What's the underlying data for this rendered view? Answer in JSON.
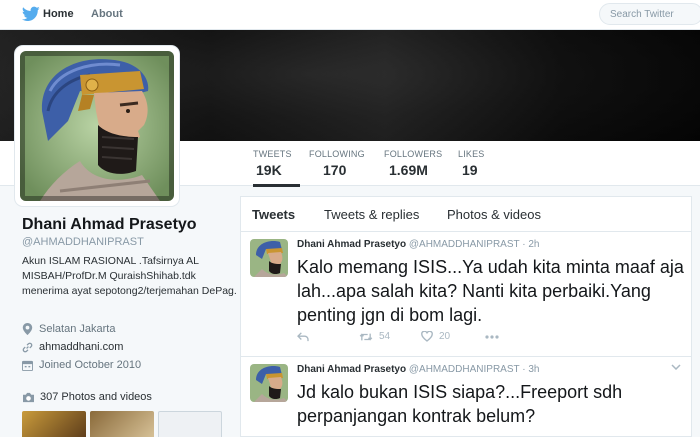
{
  "nav": {
    "home": "Home",
    "about": "About",
    "search_placeholder": "Search Twitter"
  },
  "stats": [
    {
      "label": "TWEETS",
      "value": "19K"
    },
    {
      "label": "FOLLOWING",
      "value": "170"
    },
    {
      "label": "FOLLOWERS",
      "value": "1.69M"
    },
    {
      "label": "LIKES",
      "value": "19"
    }
  ],
  "profile": {
    "name": "Dhani Ahmad Prasetyo",
    "handle": "@AHMADDHANIPRAST",
    "bio": "Akun ISLAM RASIONAL .Tafsirnya AL MISBAH/ProfDr.M QuraishShihab.tdk menerima ayat sepotong2/terjemahan DePag.",
    "location": "Selatan Jakarta",
    "website": "ahmaddhani.com",
    "joined": "Joined October 2010",
    "photos": "307 Photos and videos"
  },
  "timeline": {
    "tabs": [
      "Tweets",
      "Tweets & replies",
      "Photos & videos"
    ],
    "tweets": [
      {
        "name": "Dhani Ahmad Prasetyo",
        "meta": "@AHMADDHANIPRAST · 2h",
        "text": "Kalo memang ISIS...Ya udah kita minta maaf aja lah...apa salah kita? Nanti kita perbaiki.Yang penting jgn di bom lagi.",
        "retweets": "54",
        "likes": "20"
      },
      {
        "name": "Dhani Ahmad Prasetyo",
        "meta": "@AHMADDHANIPRAST · 3h",
        "text": "Jd kalo bukan ISIS siapa?...Freeport sdh perpanjangan kontrak belum?"
      }
    ]
  },
  "colors": {
    "brand": "#55acee",
    "text": "#292f33",
    "muted": "#8899a6"
  }
}
